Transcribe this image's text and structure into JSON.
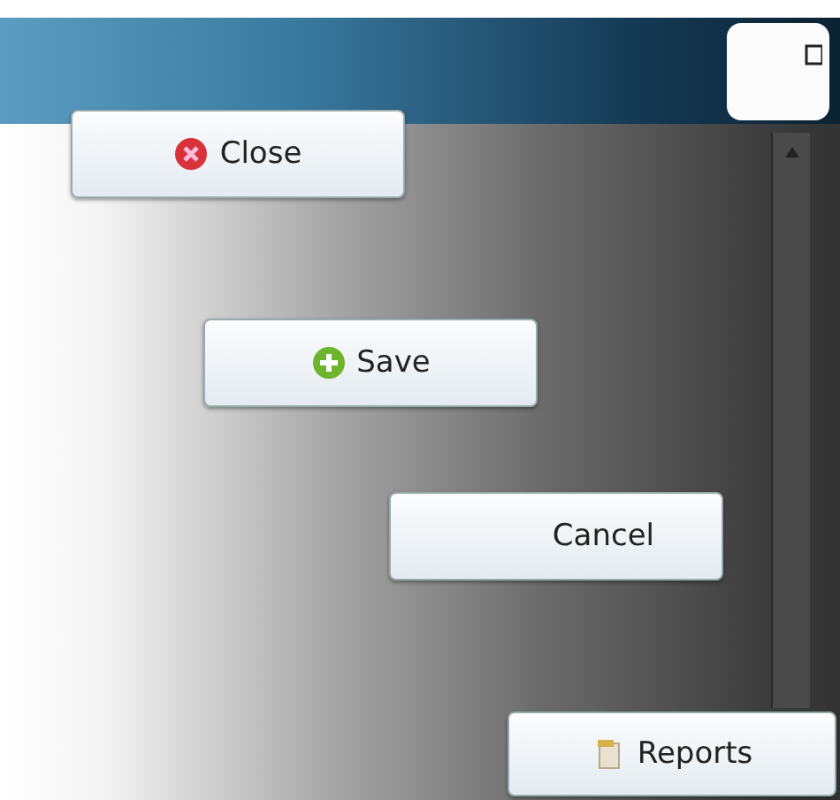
{
  "buttons": [
    {
      "label": "Close",
      "kind": "close"
    },
    {
      "label": "Save",
      "kind": "save"
    },
    {
      "label": "Cancel",
      "kind": "plain"
    },
    {
      "label": "Reports",
      "kind": "reports"
    }
  ]
}
